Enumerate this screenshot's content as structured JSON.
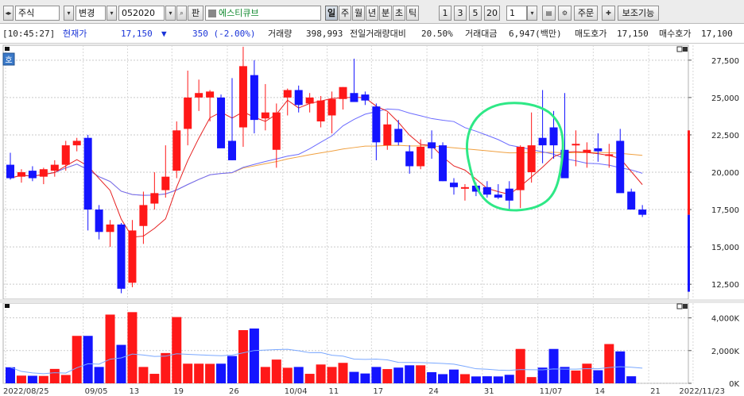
{
  "toolbar": {
    "market_label": "주식",
    "change_label": "변경",
    "code_value": "052020",
    "pan_label": "판",
    "stock_name": "에스티큐브",
    "periods": [
      "일",
      "주",
      "월",
      "년",
      "분",
      "초",
      "틱"
    ],
    "active_period": "일",
    "intervals": [
      "1",
      "3",
      "5",
      "20"
    ],
    "count_value": "1",
    "order_label": "주문",
    "aux_label": "보조기능",
    "icons": [
      "nav-arrows-icon",
      "dropdown-icon",
      "search-icon",
      "list-icon",
      "save-icon",
      "gear-icon",
      "crosshair-icon"
    ]
  },
  "quote": {
    "time": "[10:45:27]",
    "price_label": "현재가",
    "price": "17,150",
    "change_arrow": "▼",
    "change": "350 (-2.00%)",
    "volume_label": "거래량",
    "volume": "398,993",
    "prev_vol_label": "전일거래량대비",
    "prev_vol_ratio": "20.50%",
    "amount_label": "거래대금",
    "amount": "6,947(백만)",
    "ask_label": "매도호가",
    "ask": "17,150",
    "bid_label": "매수호가",
    "bid": "17,100"
  },
  "chart_badge": "호",
  "colors": {
    "up": "#ff1818",
    "down": "#1414ff",
    "ma5": "#e62020",
    "ma20": "#6b6bff",
    "ma60": "#f0a040",
    "annotation": "#2ee886"
  },
  "chart_data": {
    "type": "candlestick",
    "price_axis": {
      "ticks": [
        12500,
        15000,
        17500,
        20000,
        22500,
        25000,
        27500
      ],
      "tick_labels": [
        "12,500",
        "15,000",
        "17,500",
        "20,000",
        "22,500",
        "25,000",
        "27,500"
      ],
      "range": [
        11500,
        28500
      ]
    },
    "volume_axis": {
      "ticks": [
        0,
        2000,
        4000
      ],
      "tick_labels": [
        "0K",
        "2,000K",
        "4,000K"
      ],
      "range": [
        0,
        4900
      ]
    },
    "x_labels": [
      "2022/08/25",
      "09/05",
      "13",
      "19",
      "26",
      "10/04",
      "11",
      "17",
      "24",
      "31",
      "11/07",
      "14",
      "21",
      "2022/11/23"
    ],
    "candles": [
      {
        "o": 20500,
        "h": 21300,
        "l": 19500,
        "c": 19600,
        "v": 980
      },
      {
        "o": 19700,
        "h": 20200,
        "l": 19300,
        "c": 20000,
        "v": 470
      },
      {
        "o": 20100,
        "h": 20400,
        "l": 19400,
        "c": 19600,
        "v": 460
      },
      {
        "o": 19700,
        "h": 20300,
        "l": 19200,
        "c": 20200,
        "v": 450
      },
      {
        "o": 20100,
        "h": 20800,
        "l": 19700,
        "c": 20500,
        "v": 880
      },
      {
        "o": 20500,
        "h": 22100,
        "l": 20100,
        "c": 21800,
        "v": 510
      },
      {
        "o": 21800,
        "h": 22300,
        "l": 21400,
        "c": 22100,
        "v": 2900
      },
      {
        "o": 22300,
        "h": 22500,
        "l": 16100,
        "c": 17500,
        "v": 2900
      },
      {
        "o": 17500,
        "h": 17800,
        "l": 15500,
        "c": 16000,
        "v": 1000
      },
      {
        "o": 16000,
        "h": 16800,
        "l": 15000,
        "c": 16500,
        "v": 4200
      },
      {
        "o": 16500,
        "h": 16600,
        "l": 11900,
        "c": 12200,
        "v": 2350
      },
      {
        "o": 12600,
        "h": 16800,
        "l": 12300,
        "c": 16100,
        "v": 4350
      },
      {
        "o": 16400,
        "h": 18700,
        "l": 15200,
        "c": 17800,
        "v": 1000
      },
      {
        "o": 17900,
        "h": 20000,
        "l": 17500,
        "c": 18600,
        "v": 580
      },
      {
        "o": 18800,
        "h": 21800,
        "l": 18300,
        "c": 19700,
        "v": 1850
      },
      {
        "o": 20100,
        "h": 23400,
        "l": 19600,
        "c": 22800,
        "v": 4050
      },
      {
        "o": 22900,
        "h": 26800,
        "l": 21800,
        "c": 25000,
        "v": 1200
      },
      {
        "o": 25000,
        "h": 26200,
        "l": 24100,
        "c": 25300,
        "v": 1200
      },
      {
        "o": 25000,
        "h": 25500,
        "l": 23400,
        "c": 25400,
        "v": 1190
      },
      {
        "o": 25000,
        "h": 25200,
        "l": 23800,
        "c": 21600,
        "v": 1200
      },
      {
        "o": 22100,
        "h": 26300,
        "l": 20800,
        "c": 20800,
        "v": 1670
      },
      {
        "o": 23000,
        "h": 28400,
        "l": 21700,
        "c": 27100,
        "v": 3250
      },
      {
        "o": 26500,
        "h": 27500,
        "l": 22600,
        "c": 23500,
        "v": 3350
      },
      {
        "o": 23600,
        "h": 25900,
        "l": 22800,
        "c": 24000,
        "v": 1000
      },
      {
        "o": 21500,
        "h": 24600,
        "l": 20300,
        "c": 24000,
        "v": 1450
      },
      {
        "o": 25000,
        "h": 25600,
        "l": 23800,
        "c": 25500,
        "v": 950
      },
      {
        "o": 25500,
        "h": 25800,
        "l": 24000,
        "c": 24500,
        "v": 1000
      },
      {
        "o": 24600,
        "h": 25300,
        "l": 24000,
        "c": 25000,
        "v": 580
      },
      {
        "o": 23400,
        "h": 25100,
        "l": 23000,
        "c": 24800,
        "v": 1150
      },
      {
        "o": 23800,
        "h": 25400,
        "l": 22600,
        "c": 24900,
        "v": 1000
      },
      {
        "o": 24900,
        "h": 25700,
        "l": 24200,
        "c": 25700,
        "v": 1250
      },
      {
        "o": 25300,
        "h": 27600,
        "l": 24800,
        "c": 24700,
        "v": 700
      },
      {
        "o": 25200,
        "h": 25400,
        "l": 24500,
        "c": 24800,
        "v": 600
      },
      {
        "o": 24400,
        "h": 24600,
        "l": 20800,
        "c": 22000,
        "v": 1000
      },
      {
        "o": 21800,
        "h": 24000,
        "l": 21500,
        "c": 23200,
        "v": 870
      },
      {
        "o": 22900,
        "h": 23500,
        "l": 21800,
        "c": 22000,
        "v": 960
      },
      {
        "o": 21400,
        "h": 21800,
        "l": 19900,
        "c": 20400,
        "v": 1100
      },
      {
        "o": 20400,
        "h": 22200,
        "l": 20200,
        "c": 21700,
        "v": 1100
      },
      {
        "o": 22000,
        "h": 22800,
        "l": 20900,
        "c": 21600,
        "v": 680
      },
      {
        "o": 21800,
        "h": 22000,
        "l": 19400,
        "c": 19400,
        "v": 560
      },
      {
        "o": 19300,
        "h": 19600,
        "l": 18500,
        "c": 19000,
        "v": 840
      },
      {
        "o": 19000,
        "h": 19200,
        "l": 18100,
        "c": 19000,
        "v": 560
      },
      {
        "o": 19100,
        "h": 19300,
        "l": 18400,
        "c": 18700,
        "v": 420
      },
      {
        "o": 19000,
        "h": 19400,
        "l": 18300,
        "c": 18500,
        "v": 430
      },
      {
        "o": 18500,
        "h": 19200,
        "l": 18200,
        "c": 18300,
        "v": 420
      },
      {
        "o": 18900,
        "h": 19400,
        "l": 17500,
        "c": 18100,
        "v": 520
      },
      {
        "o": 18800,
        "h": 21800,
        "l": 17600,
        "c": 21700,
        "v": 2100
      },
      {
        "o": 20000,
        "h": 24000,
        "l": 19300,
        "c": 21800,
        "v": 380
      },
      {
        "o": 22300,
        "h": 25500,
        "l": 20600,
        "c": 21800,
        "v": 960
      },
      {
        "o": 23000,
        "h": 24100,
        "l": 20900,
        "c": 21800,
        "v": 2100
      },
      {
        "o": 21500,
        "h": 25300,
        "l": 19600,
        "c": 19600,
        "v": 1000
      },
      {
        "o": 21900,
        "h": 22800,
        "l": 20400,
        "c": 21900,
        "v": 780
      },
      {
        "o": 21300,
        "h": 22000,
        "l": 20300,
        "c": 21500,
        "v": 1200
      },
      {
        "o": 21600,
        "h": 22600,
        "l": 20700,
        "c": 21400,
        "v": 800
      },
      {
        "o": 21100,
        "h": 21900,
        "l": 20300,
        "c": 21200,
        "v": 2400
      },
      {
        "o": 22100,
        "h": 22900,
        "l": 18900,
        "c": 18600,
        "v": 1950
      },
      {
        "o": 18700,
        "h": 18900,
        "l": 17500,
        "c": 17500,
        "v": 430
      },
      {
        "o": 17500,
        "h": 17800,
        "l": 17000,
        "c": 17150,
        "v": 0
      }
    ]
  }
}
